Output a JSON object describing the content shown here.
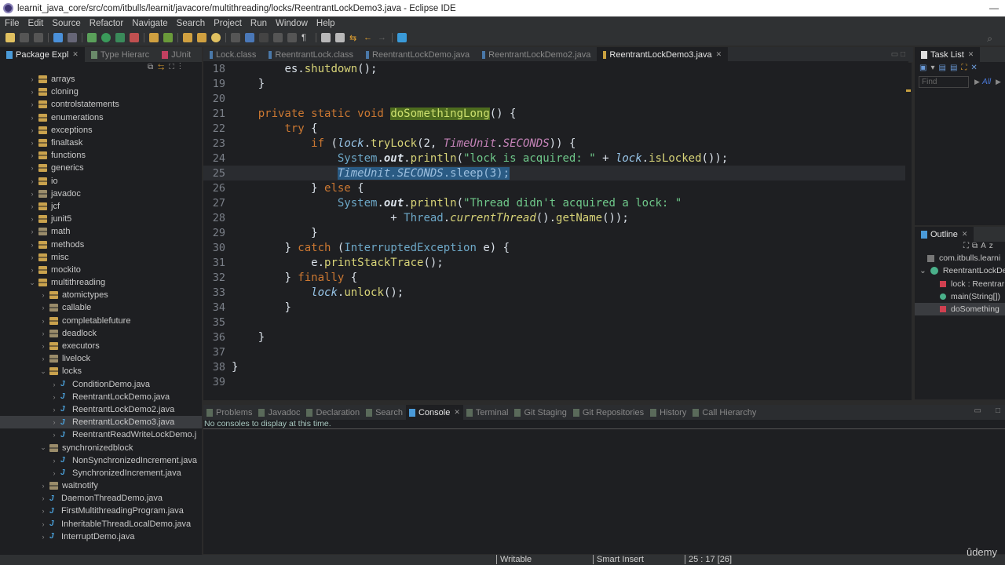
{
  "window": {
    "title": "learnit_java_core/src/com/itbulls/learnit/javacore/multithreading/locks/ReentrantLockDemo3.java - Eclipse IDE"
  },
  "menu": [
    "File",
    "Edit",
    "Source",
    "Refactor",
    "Navigate",
    "Search",
    "Project",
    "Run",
    "Window",
    "Help"
  ],
  "left_tabs": [
    {
      "label": "Package Expl",
      "active": true
    },
    {
      "label": "Type Hierarc",
      "active": false
    },
    {
      "label": "JUnit",
      "active": false
    }
  ],
  "editor_tabs": [
    {
      "label": "Lock.class",
      "active": false
    },
    {
      "label": "ReentrantLock.class",
      "active": false
    },
    {
      "label": "ReentrantLockDemo.java",
      "active": false
    },
    {
      "label": "ReentrantLockDemo2.java",
      "active": false
    },
    {
      "label": "ReentrantLockDemo3.java",
      "active": true
    }
  ],
  "tree": [
    {
      "label": "arrays",
      "type": "pkg",
      "indent": 1,
      "arrow": ">"
    },
    {
      "label": "cloning",
      "type": "pkg",
      "indent": 1,
      "arrow": ">"
    },
    {
      "label": "controlstatements",
      "type": "pkg",
      "indent": 1,
      "arrow": ">"
    },
    {
      "label": "enumerations",
      "type": "pkg",
      "indent": 1,
      "arrow": ">"
    },
    {
      "label": "exceptions",
      "type": "pkg",
      "indent": 1,
      "arrow": ">"
    },
    {
      "label": "finaltask",
      "type": "pkg",
      "indent": 1,
      "arrow": ">"
    },
    {
      "label": "functions",
      "type": "pkg",
      "indent": 1,
      "arrow": ">"
    },
    {
      "label": "generics",
      "type": "pkg",
      "indent": 1,
      "arrow": ">"
    },
    {
      "label": "io",
      "type": "pkg",
      "indent": 1,
      "arrow": ">"
    },
    {
      "label": "javadoc",
      "type": "pkg-empty",
      "indent": 1,
      "arrow": ">"
    },
    {
      "label": "jcf",
      "type": "pkg",
      "indent": 1,
      "arrow": ">"
    },
    {
      "label": "junit5",
      "type": "pkg",
      "indent": 1,
      "arrow": ">"
    },
    {
      "label": "math",
      "type": "pkg-empty",
      "indent": 1,
      "arrow": ">"
    },
    {
      "label": "methods",
      "type": "pkg",
      "indent": 1,
      "arrow": ">"
    },
    {
      "label": "misc",
      "type": "pkg",
      "indent": 1,
      "arrow": ">"
    },
    {
      "label": "mockito",
      "type": "pkg",
      "indent": 1,
      "arrow": ">"
    },
    {
      "label": "multithreading",
      "type": "pkg",
      "indent": 1,
      "arrow": "v"
    },
    {
      "label": "atomictypes",
      "type": "pkg",
      "indent": 2,
      "arrow": ">"
    },
    {
      "label": "callable",
      "type": "pkg-empty",
      "indent": 2,
      "arrow": ">"
    },
    {
      "label": "completablefuture",
      "type": "pkg",
      "indent": 2,
      "arrow": ">"
    },
    {
      "label": "deadlock",
      "type": "pkg-empty",
      "indent": 2,
      "arrow": ">"
    },
    {
      "label": "executors",
      "type": "pkg",
      "indent": 2,
      "arrow": ">"
    },
    {
      "label": "livelock",
      "type": "pkg-empty",
      "indent": 2,
      "arrow": ">"
    },
    {
      "label": "locks",
      "type": "pkg",
      "indent": 2,
      "arrow": "v"
    },
    {
      "label": "ConditionDemo.java",
      "type": "java",
      "indent": 3,
      "arrow": ">"
    },
    {
      "label": "ReentrantLockDemo.java",
      "type": "java",
      "indent": 3,
      "arrow": ">"
    },
    {
      "label": "ReentrantLockDemo2.java",
      "type": "java",
      "indent": 3,
      "arrow": ">"
    },
    {
      "label": "ReentrantLockDemo3.java",
      "type": "java",
      "indent": 3,
      "arrow": ">",
      "selected": true
    },
    {
      "label": "ReentrantReadWriteLockDemo.j",
      "type": "java",
      "indent": 3,
      "arrow": ">"
    },
    {
      "label": "synchronizedblock",
      "type": "pkg-empty",
      "indent": 2,
      "arrow": "v"
    },
    {
      "label": "NonSynchronizedIncrement.java",
      "type": "java",
      "indent": 3,
      "arrow": ">"
    },
    {
      "label": "SynchronizedIncrement.java",
      "type": "java",
      "indent": 3,
      "arrow": ">"
    },
    {
      "label": "waitnotify",
      "type": "pkg-empty",
      "indent": 2,
      "arrow": ">"
    },
    {
      "label": "DaemonThreadDemo.java",
      "type": "java",
      "indent": 2,
      "arrow": ">"
    },
    {
      "label": "FirstMultithreadingProgram.java",
      "type": "java",
      "indent": 2,
      "arrow": ">"
    },
    {
      "label": "InheritableThreadLocalDemo.java",
      "type": "java",
      "indent": 2,
      "arrow": ">"
    },
    {
      "label": "InterruptDemo.java",
      "type": "java",
      "indent": 2,
      "arrow": ">"
    }
  ],
  "code_lines": [
    {
      "n": "18",
      "html": "        <span class='code'>es.</span><span class='mth'>shutdown</span><span class='code'>();</span>"
    },
    {
      "n": "19",
      "html": "    <span class='code'>}</span>"
    },
    {
      "n": "20",
      "html": ""
    },
    {
      "n": "21",
      "html": "    <span class='kw'>private static void</span> <span class='hl-name'>doSomethingLong</span><span class='code'>() {</span>"
    },
    {
      "n": "22",
      "html": "        <span class='kw'>try</span> <span class='code'>{</span>"
    },
    {
      "n": "23",
      "html": "            <span class='kw'>if</span> <span class='code'>(</span><span class='fld'>lock</span><span class='code'>.</span><span class='mth'>tryLock</span><span class='code'>(2, </span><span class='static'>TimeUnit</span><span class='code'>.</span><span class='static'>SECONDS</span><span class='code'>)) {</span>"
    },
    {
      "n": "24",
      "html": "                <span class='sys'>System</span><span class='code'>.</span><span class='bold-out'>out</span><span class='code'>.</span><span class='mth'>println</span><span class='code'>(</span><span class='str'>\"lock is acquired: \"</span><span class='code'> + </span><span class='fld'>lock</span><span class='code'>.</span><span class='mth'>isLocked</span><span class='code'>());</span>"
    },
    {
      "n": "25",
      "html": "                <span class='sel-text'><i>TimeUnit.SECONDS</i>.sleep(3);</span>",
      "current": true
    },
    {
      "n": "26",
      "html": "            <span class='code'>} </span><span class='kw'>else</span><span class='code'> {</span>"
    },
    {
      "n": "27",
      "html": "                <span class='sys'>System</span><span class='code'>.</span><span class='bold-out'>out</span><span class='code'>.</span><span class='mth'>println</span><span class='code'>(</span><span class='str'>\"Thread didn't acquired a lock: \"</span>"
    },
    {
      "n": "28",
      "html": "                        <span class='code'>+ </span><span class='sys'>Thread</span><span class='code'>.</span><span class='mth'><i>currentThread</i></span><span class='code'>().</span><span class='mth'>getName</span><span class='code'>());</span>"
    },
    {
      "n": "29",
      "html": "            <span class='code'>}</span>"
    },
    {
      "n": "30",
      "html": "        <span class='code'>} </span><span class='kw'>catch</span><span class='code'> (</span><span class='sys'>InterruptedException</span><span class='code'> e) {</span>"
    },
    {
      "n": "31",
      "html": "            <span class='code'>e.</span><span class='mth'>printStackTrace</span><span class='code'>();</span>"
    },
    {
      "n": "32",
      "html": "        <span class='code'>} </span><span class='kw'>finally</span><span class='code'> {</span>"
    },
    {
      "n": "33",
      "html": "            <span class='fld'>lock</span><span class='code'>.</span><span class='mth'>unlock</span><span class='code'>();</span>"
    },
    {
      "n": "34",
      "html": "        <span class='code'>}</span>"
    },
    {
      "n": "35",
      "html": ""
    },
    {
      "n": "36",
      "html": "    <span class='code'>}</span>"
    },
    {
      "n": "37",
      "html": ""
    },
    {
      "n": "38",
      "html": "<span class='code'>}</span>"
    },
    {
      "n": "39",
      "html": ""
    }
  ],
  "task_list": {
    "title": "Task List",
    "find_placeholder": "Find",
    "filter_all": "All"
  },
  "outline": {
    "title": "Outline",
    "items": [
      {
        "label": "com.itbulls.learni",
        "icon": "package-icon"
      },
      {
        "label": "ReentrantLockDe",
        "icon": "class-icon"
      },
      {
        "label": "lock : Reentrar",
        "icon": "private-field-icon"
      },
      {
        "label": "main(String[])",
        "icon": "public-method-icon"
      },
      {
        "label": "doSomething",
        "icon": "private-method-icon",
        "selected": true
      }
    ]
  },
  "console_tabs": [
    {
      "label": "Problems",
      "active": false
    },
    {
      "label": "Javadoc",
      "active": false
    },
    {
      "label": "Declaration",
      "active": false
    },
    {
      "label": "Search",
      "active": false
    },
    {
      "label": "Console",
      "active": true
    },
    {
      "label": "Terminal",
      "active": false
    },
    {
      "label": "Git Staging",
      "active": false
    },
    {
      "label": "Git Repositories",
      "active": false
    },
    {
      "label": "History",
      "active": false
    },
    {
      "label": "Call Hierarchy",
      "active": false
    }
  ],
  "console_message": "No consoles to display at this time.",
  "status": {
    "writable": "Writable",
    "insert_mode": "Smart Insert",
    "position": "25 : 17 [26]"
  },
  "watermark": "ûdemy"
}
